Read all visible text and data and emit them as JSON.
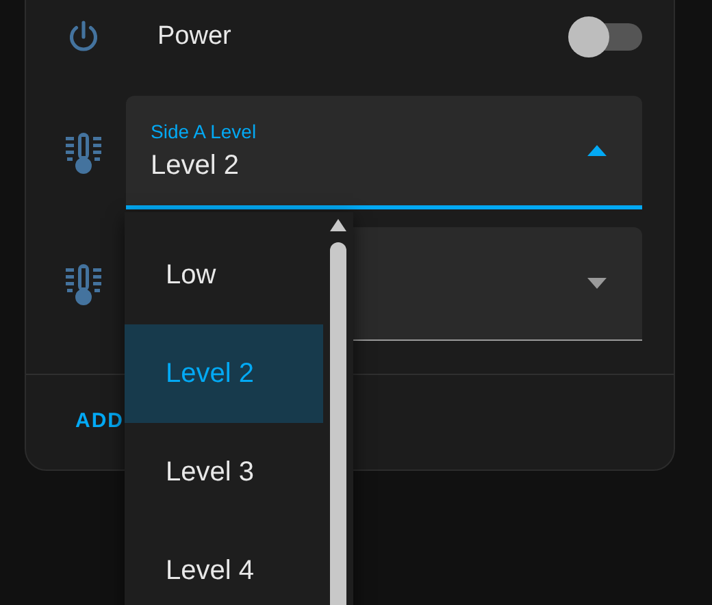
{
  "power": {
    "label": "Power",
    "on": false
  },
  "selects": [
    {
      "label": "Side A Level",
      "value": "Level 2",
      "expanded": true
    },
    {
      "expanded": false
    }
  ],
  "footer": {
    "button": "ADD"
  },
  "menu": {
    "items": [
      {
        "label": "Low",
        "selected": false
      },
      {
        "label": "Level 2",
        "selected": true
      },
      {
        "label": "Level 3",
        "selected": false
      },
      {
        "label": "Level 4",
        "selected": false
      }
    ]
  }
}
